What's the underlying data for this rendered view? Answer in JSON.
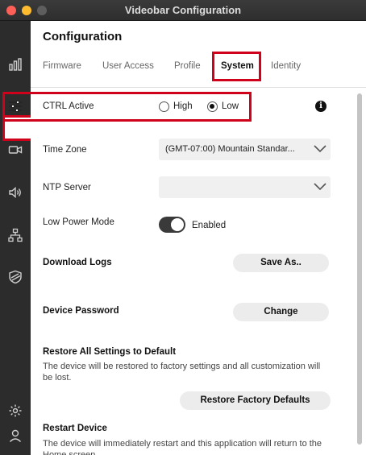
{
  "window": {
    "title": "Videobar Configuration"
  },
  "sidebar": {
    "items": [
      {
        "name": "stats-icon"
      },
      {
        "name": "settings-sliders-icon"
      },
      {
        "name": "camera-icon"
      },
      {
        "name": "speaker-icon"
      },
      {
        "name": "network-icon"
      },
      {
        "name": "shield-icon"
      }
    ],
    "bottom": [
      {
        "name": "gear-icon"
      },
      {
        "name": "user-icon"
      }
    ]
  },
  "page": {
    "title": "Configuration",
    "tabs": [
      {
        "label": "Firmware"
      },
      {
        "label": "User Access"
      },
      {
        "label": "Profile"
      },
      {
        "label": "System",
        "active": true
      },
      {
        "label": "Identity"
      }
    ]
  },
  "system": {
    "ctrl_active": {
      "label": "CTRL Active",
      "options": [
        "High",
        "Low"
      ],
      "selected": "Low"
    },
    "time_zone": {
      "label": "Time Zone",
      "value": "(GMT-07:00) Mountain Standar..."
    },
    "ntp_server": {
      "label": "NTP Server",
      "value": ""
    },
    "low_power_mode": {
      "label": "Low Power Mode",
      "state": "Enabled",
      "on": true
    },
    "download_logs": {
      "label": "Download Logs",
      "button": "Save As.."
    },
    "device_password": {
      "label": "Device Password",
      "button": "Change"
    },
    "restore": {
      "label": "Restore All Settings to Default",
      "description": "The device will be restored to factory settings and all customization will be lost.",
      "button": "Restore Factory Defaults"
    },
    "restart": {
      "label": "Restart Device",
      "description": "The device will immediately restart and this application will return to the Home screen."
    }
  },
  "colors": {
    "highlight": "#d0021b",
    "sidebar": "#2c2c2c"
  }
}
